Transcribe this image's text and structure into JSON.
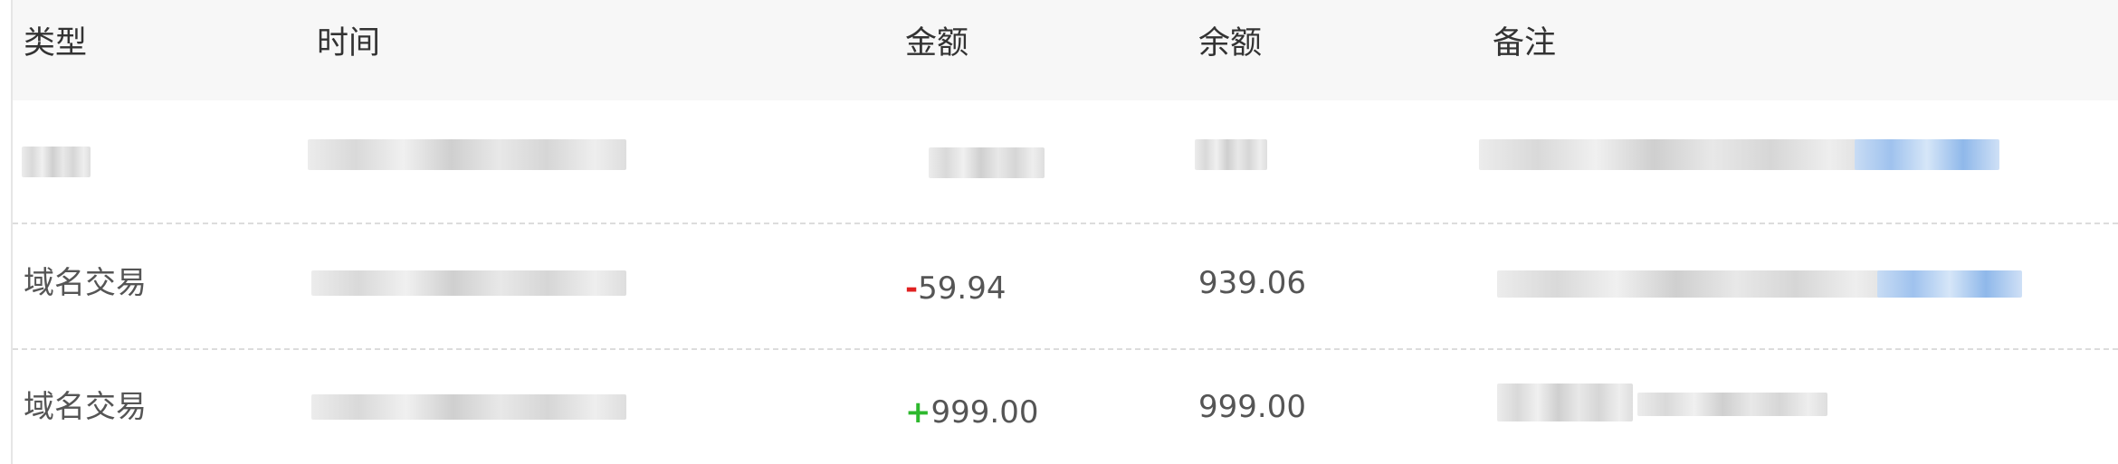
{
  "columns": {
    "type": "类型",
    "time": "时间",
    "amount": "金额",
    "balance": "余额",
    "remark": "备注"
  },
  "rows": [
    {
      "type": "",
      "time": "",
      "amount_sign": "",
      "amount_value": "",
      "balance": "",
      "remark": ""
    },
    {
      "type": "域名交易",
      "time": "",
      "amount_sign": "-",
      "amount_value": "59.94",
      "balance": "939.06",
      "remark": ""
    },
    {
      "type": "域名交易",
      "time": "",
      "amount_sign": "+",
      "amount_value": "999.00",
      "balance": "999.00",
      "remark": ""
    }
  ],
  "colors": {
    "header_bg": "#f7f7f7",
    "negative": "#e02020",
    "positive": "#2db82d",
    "text": "#555555"
  }
}
